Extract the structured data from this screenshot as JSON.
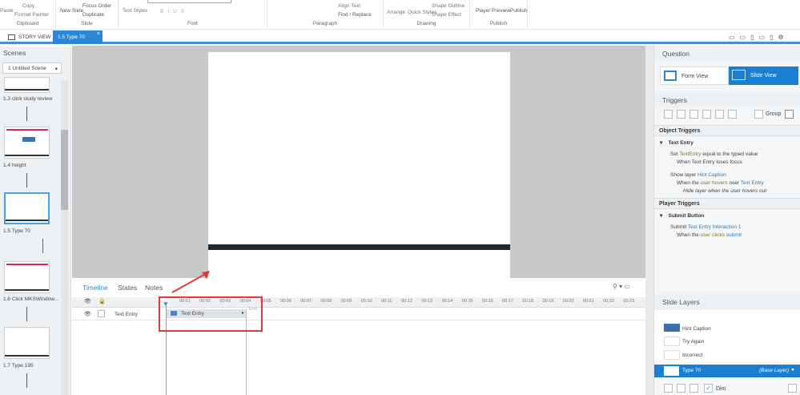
{
  "ribbon": {
    "clipboard": {
      "paste": "Paste",
      "copy": "Copy",
      "format_painter": "Format Painter",
      "label": "Clipboard"
    },
    "slide": {
      "new_slide": "New Slide",
      "focus_order": "Focus Order",
      "duplicate": "Duplicate",
      "label": "Slide"
    },
    "font": {
      "text_styles": "Text Styles",
      "label": "Font"
    },
    "paragraph": {
      "align_text": "Align Text",
      "find_replace": "Find / Replace",
      "label": "Paragraph"
    },
    "drawing": {
      "arrange": "Arrange",
      "quick_styles": "Quick Styles",
      "shape_outline": "Shape Outline",
      "shape_effect": "Shape Effect",
      "label": "Drawing"
    },
    "publish": {
      "player": "Player",
      "preview": "Preview",
      "publish": "Publish",
      "label": "Publish"
    }
  },
  "tabs": {
    "story_view": "STORY VIEW",
    "active": "1.5 Type 70"
  },
  "scenes": {
    "title": "Scenes",
    "selector": "1 Untitled Scene",
    "slides": [
      {
        "label": "1.3 click study review"
      },
      {
        "label": "1.4 height"
      },
      {
        "label": "1.5 Type 70"
      },
      {
        "label": "1.6 Click MKSWindow..."
      },
      {
        "label": "1.7 Type 195"
      }
    ]
  },
  "timeline": {
    "tabs": [
      "Timeline",
      "States",
      "Notes"
    ],
    "row_label": "Text Entry",
    "bar_label": "Text Entry",
    "end_label": "End",
    "ticks": [
      "00:01",
      "00:02",
      "00:03",
      "00:04",
      "00:05",
      "00:06",
      "00:07",
      "00:08",
      "00:09",
      "00:10",
      "00:11",
      "00:12",
      "00:13",
      "00:14",
      "00:15",
      "00:16",
      "00:17",
      "00:18",
      "00:19",
      "00:20",
      "00:21",
      "00:22",
      "00:23"
    ]
  },
  "question": {
    "title": "Question",
    "form_view": "Form View",
    "slide_view": "Slide View"
  },
  "triggers": {
    "title": "Triggers",
    "group": "Group",
    "object_triggers": "Object Triggers",
    "object_name": "Text Entry",
    "t1": {
      "a": "Set ",
      "b": "TextEntry",
      "c": " equal to the typed value",
      "when": "When Text Entry loses focus"
    },
    "t2": {
      "a": "Show layer ",
      "b": "Hint Caption",
      "w1": "When the ",
      "w2": "user hovers",
      "w3": " over ",
      "w4": "Text Entry",
      "extra": "Hide layer when the user hovers out"
    },
    "player_triggers": "Player Triggers",
    "player_name": "Submit Button",
    "t3": {
      "a": "Submit ",
      "b": "Text Entry Interaction 1",
      "w1": "When the ",
      "w2": "user clicks",
      "w3": " ",
      "w4": "submit"
    }
  },
  "layers": {
    "title": "Slide Layers",
    "items": [
      "Hint Caption",
      "Try Again",
      "Incorrect"
    ],
    "base": "Type 70",
    "base_tag": "(Base Layer)",
    "dim": "Dim"
  },
  "colors": {
    "accent": "#1b7fd1",
    "tab": "#4a90d0"
  }
}
